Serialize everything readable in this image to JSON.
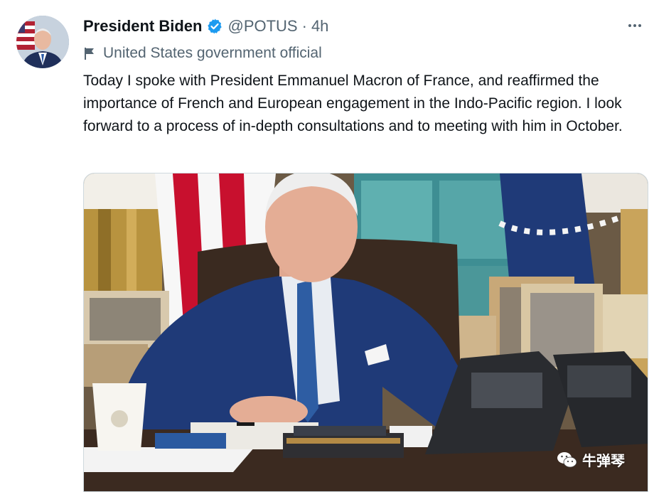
{
  "tweet": {
    "author_name": "President Biden",
    "handle": "@POTUS",
    "separator": "·",
    "time": "4h",
    "label": "United States government official",
    "text": "Today I spoke with President Emmanuel Macron of France, and reaffirmed the importance of French and European engagement in the Indo-Pacific region. I look forward to a process of in-depth consultations and to meeting with him in October.",
    "media_alt": "President Biden on a phone call at his desk in the Oval Office"
  },
  "watermark": {
    "text": "牛弹琴"
  },
  "icons": {
    "verified": "verified-badge-icon",
    "more": "more-options-icon",
    "label": "flag-icon",
    "watermark": "wechat-icon"
  },
  "colors": {
    "verified": "#1d9bf0",
    "text": "#0f1419",
    "muted": "#536471"
  }
}
